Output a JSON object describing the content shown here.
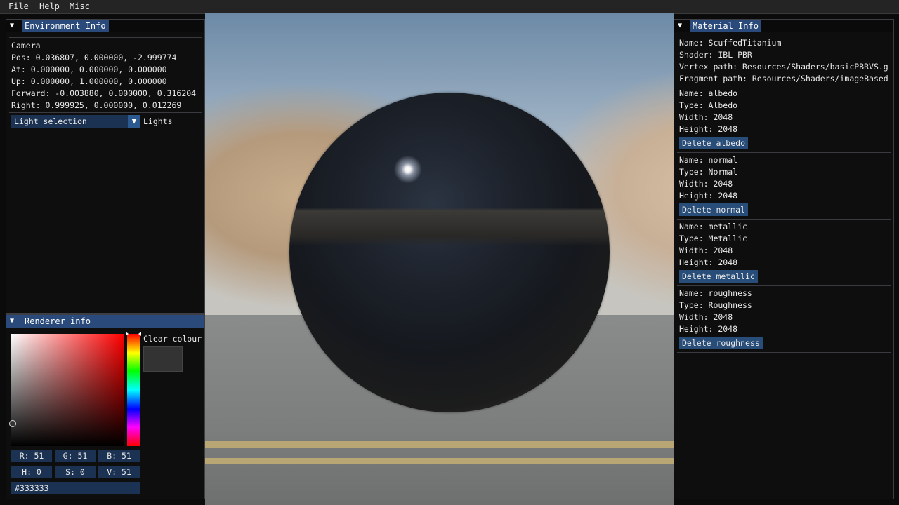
{
  "menu": {
    "items": [
      "File",
      "Help",
      "Misc"
    ]
  },
  "environment": {
    "title": "Environment Info",
    "camera_label": "Camera",
    "pos": "Pos: 0.036807, 0.000000, -2.999774",
    "at": "At: 0.000000, 0.000000, 0.000000",
    "up": "Up: 0.000000, 1.000000, 0.000000",
    "forward": "Forward: -0.003880, 0.000000, 0.316204",
    "right": "Right: 0.999925, 0.000000, 0.012269",
    "light_combo_value": "Light selection",
    "light_combo_label": "Lights"
  },
  "renderer": {
    "title": "Renderer info",
    "clear_colour_label": "Clear colour",
    "clear_colour": "#333333",
    "r": "R: 51",
    "g": "G: 51",
    "b": "B: 51",
    "h": "H:  0",
    "s": "S:  0",
    "v": "V: 51",
    "hex": "#333333"
  },
  "material": {
    "title": "Material Info",
    "name": "Name: ScuffedTitanium",
    "shader": "Shader: IBL PBR",
    "vertex_path": "Vertex path: Resources/Shaders/basicPBRVS.g",
    "fragment_path": "Fragment path: Resources/Shaders/imageBased",
    "textures": [
      {
        "name": "Name: albedo",
        "type": "Type: Albedo",
        "width": "Width: 2048",
        "height": "Height: 2048",
        "delete_label": "Delete albedo"
      },
      {
        "name": "Name: normal",
        "type": "Type: Normal",
        "width": "Width: 2048",
        "height": "Height: 2048",
        "delete_label": "Delete normal"
      },
      {
        "name": "Name: metallic",
        "type": "Type: Metallic",
        "width": "Width: 2048",
        "height": "Height: 2048",
        "delete_label": "Delete metallic"
      },
      {
        "name": "Name: roughness",
        "type": "Type: Roughness",
        "width": "Width: 2048",
        "height": "Height: 2048",
        "delete_label": "Delete roughness"
      }
    ]
  },
  "colors": {
    "accent": "#294a7a",
    "button": "#284d78",
    "frame": "#1c3252",
    "clear": "#333333"
  }
}
